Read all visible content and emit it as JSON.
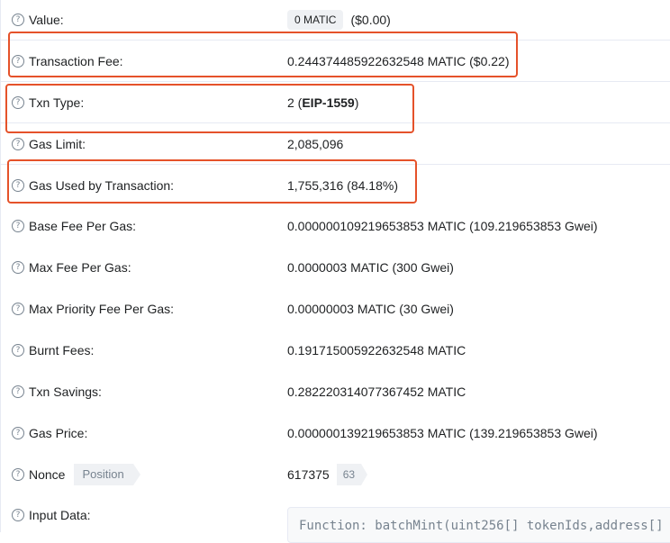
{
  "rows": [
    {
      "id": "value",
      "label": "Value:",
      "badge": "0 MATIC",
      "value": "($0.00)"
    },
    {
      "id": "txn_fee",
      "label": "Transaction Fee:",
      "value": "0.244374485922632548 MATIC ($0.22)"
    },
    {
      "id": "txn_type",
      "label": "Txn Type:",
      "value_prefix": "2 (",
      "value_bold": "EIP-1559",
      "value_suffix": ")"
    },
    {
      "id": "gas_limit",
      "label": "Gas Limit:",
      "value": "2,085,096"
    },
    {
      "id": "gas_used",
      "label": "Gas Used by Transaction:",
      "value": "1,755,316 (84.18%)"
    },
    {
      "id": "base_fee",
      "label": "Base Fee Per Gas:",
      "value": "0.000000109219653853 MATIC (109.219653853 Gwei)"
    },
    {
      "id": "max_fee",
      "label": "Max Fee Per Gas:",
      "value": "0.0000003 MATIC (300 Gwei)"
    },
    {
      "id": "max_priority",
      "label": "Max Priority Fee Per Gas:",
      "value": "0.00000003 MATIC (30 Gwei)"
    },
    {
      "id": "burnt",
      "label": "Burnt Fees:",
      "value": "0.191715005922632548 MATIC"
    },
    {
      "id": "savings",
      "label": "Txn Savings:",
      "value": "0.282220314077367452 MATIC"
    },
    {
      "id": "gas_price",
      "label": "Gas Price:",
      "value": "0.000000139219653853 MATIC (139.219653853 Gwei)"
    },
    {
      "id": "nonce",
      "label": "Nonce",
      "tag": "Position",
      "value": "617375",
      "position": "63"
    },
    {
      "id": "input",
      "label": "Input Data:",
      "code": "Function: batchMint(uint256[] tokenIds,address[]"
    }
  ],
  "help_icon": "question-circle-icon",
  "colors": {
    "highlight": "#e5522a",
    "divider": "#e7eaf3",
    "muted": "#77838f"
  }
}
